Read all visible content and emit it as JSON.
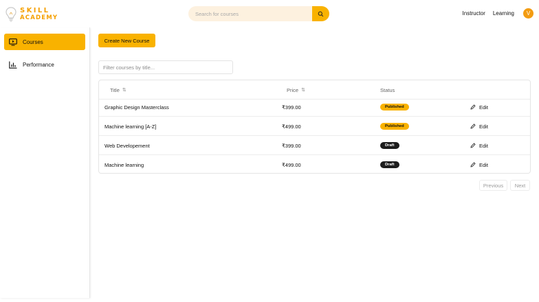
{
  "brand": {
    "line1": "SKILL",
    "line2": "ACADEMY",
    "color": "#f5a000"
  },
  "search": {
    "placeholder": "Search for courses",
    "icon": "search-icon"
  },
  "nav": {
    "instructor": "Instructor",
    "learning": "Learning",
    "avatar_initial": "V"
  },
  "sidebar": {
    "items": [
      {
        "label": "Courses",
        "icon": "monitor-play-icon",
        "active": true
      },
      {
        "label": "Performance",
        "icon": "bar-chart-icon",
        "active": false
      }
    ]
  },
  "main": {
    "create_label": "Create New Course",
    "filter_placeholder": "Filter courses by title...",
    "columns": {
      "title": "Title",
      "price": "Price",
      "status": "Status"
    },
    "sort_glyph": "⇅",
    "rows": [
      {
        "title": "Graphic Design Masterclass",
        "price": "₹399.00",
        "status": "Published",
        "edit": "Edit"
      },
      {
        "title": "Machine learning [A-Z]",
        "price": "₹499.00",
        "status": "Published",
        "edit": "Edit"
      },
      {
        "title": "Web Developement",
        "price": "₹399.00",
        "status": "Draft",
        "edit": "Edit"
      },
      {
        "title": "Machine learning",
        "price": "₹499.00",
        "status": "Draft",
        "edit": "Edit"
      }
    ],
    "pagination": {
      "previous": "Previous",
      "next": "Next"
    }
  },
  "colors": {
    "accent": "#f9b200",
    "draft": "#1d1d1d",
    "search_bg": "#fdf1df"
  }
}
